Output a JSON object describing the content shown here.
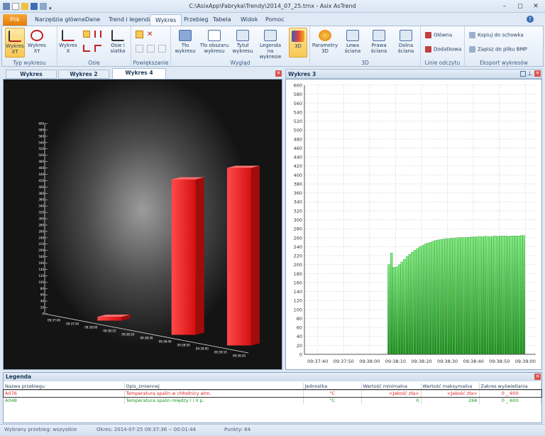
{
  "window": {
    "title": "C:\\AsixApp\\Fabryka\\Trendy\\2014_07_25.trnx - Asix AsTrend",
    "min": "–",
    "restore": "◻",
    "close": "✕"
  },
  "tabs": [
    {
      "label": "Plik"
    },
    {
      "label": "Narzędzia główne"
    },
    {
      "label": "Dane"
    },
    {
      "label": "Trend i legenda"
    },
    {
      "label": "Wykres"
    },
    {
      "label": "Przebieg"
    },
    {
      "label": "Tabela"
    },
    {
      "label": "Widok"
    },
    {
      "label": "Pomoc"
    }
  ],
  "ribbon": {
    "groups": {
      "typ": "Typ wykresu",
      "osie": "Osie",
      "pow": "Powiększanie",
      "wyglad": "Wygląd",
      "d3": "3D",
      "linie": "Linie odczytu",
      "eksport": "Eksport wykresów"
    },
    "wykres_xt": "Wykres XT",
    "wykres_xy": "Wykres XY",
    "wykres_x": "Wykres X",
    "osie_siatka": "Osie i siatka",
    "tlo_wykresu": "Tło wykresu",
    "tlo_obszaru": "Tło obszaru wykresu",
    "tytul": "Tytuł wykresu",
    "legenda_na": "Legenda na wykresie",
    "btn3d": "3D",
    "parametry": "Parametry 3D",
    "lewa": "Lewa ściana",
    "prawa": "Prawa ściana",
    "dolna": "Dolna ściana",
    "glowna": "Główna",
    "dodatkowa": "Dodatkowa",
    "kopiuj": "Kopiuj do schowka",
    "zapisz": "Zapisz do pliku BMP"
  },
  "doc_tabs": [
    {
      "label": "Wykres"
    },
    {
      "label": "Wykres 2"
    },
    {
      "label": "Wykres 4"
    }
  ],
  "panel3_title": "Wykres 3",
  "chart_data": [
    {
      "type": "bar",
      "title": "Wykres 4",
      "note": "3D bar chart",
      "ylim": [
        0,
        600
      ],
      "ytick_labels": [
        "0",
        "20",
        "40",
        "60",
        "80",
        "100",
        "120",
        "140",
        "160",
        "180",
        "200",
        "220",
        "240",
        "260",
        "280",
        "300",
        "320",
        "340",
        "360",
        "380",
        "400",
        "420",
        "440",
        "460",
        "480",
        "500",
        "520",
        "540",
        "560",
        "580",
        "600"
      ],
      "categories": [
        "09:37:40",
        "09:37:50",
        "09:38:00",
        "09:38:10",
        "09:38:20",
        "09:38:30",
        "09:38:40",
        "09:38:50",
        "09:39:00",
        "09:39:10",
        "09:39:20"
      ],
      "bar_colors": [
        "#e8191b"
      ],
      "values": [
        0,
        0,
        0,
        12,
        0,
        0,
        0,
        490,
        0,
        0,
        560
      ]
    },
    {
      "type": "bar",
      "title": "Wykres 3",
      "ylim": [
        0,
        600
      ],
      "grid": true,
      "color": "#2dcb2d",
      "ytick_labels": [
        "0",
        "20",
        "40",
        "60",
        "80",
        "100",
        "120",
        "140",
        "160",
        "180",
        "200",
        "220",
        "240",
        "260",
        "280",
        "300",
        "320",
        "340",
        "360",
        "380",
        "400",
        "420",
        "440",
        "460",
        "480",
        "500",
        "520",
        "540",
        "560",
        "580",
        "600"
      ],
      "xtick_labels": [
        "09:37:40",
        "09:37:50",
        "09:38:00",
        "09:38:10",
        "09:38:20",
        "09:38:30",
        "09:38:40",
        "09:38:50",
        "09:39:00",
        "09:39:10",
        "09:39:20"
      ],
      "x_start": "09:37:36",
      "x_step_s": 1,
      "values": [
        0,
        0,
        0,
        0,
        0,
        0,
        0,
        0,
        0,
        0,
        0,
        0,
        0,
        0,
        0,
        0,
        0,
        0,
        0,
        0,
        0,
        0,
        0,
        0,
        0,
        0,
        0,
        0,
        0,
        0,
        0,
        200,
        226,
        194,
        195,
        200,
        206,
        212,
        218,
        223,
        228,
        232,
        236,
        240,
        243,
        246,
        248,
        250,
        252,
        254,
        255,
        256,
        257,
        258,
        258,
        259,
        259,
        260,
        260,
        261,
        260,
        261,
        261,
        262,
        262,
        262,
        263,
        262,
        263,
        263,
        262,
        263,
        264,
        263,
        264,
        264,
        264,
        263,
        264,
        264,
        264,
        264,
        265,
        265
      ]
    }
  ],
  "legend": {
    "title": "Legenda",
    "headers": [
      "Nazwa przebiegu",
      "Opis_zmiennej",
      "Jednostka",
      "Wartość minimalna",
      "Wartość maksymalna",
      "Zakres wyświetlania"
    ],
    "rows": [
      {
        "name": "A076",
        "desc": "Temperatura spalin w chłodnicy atm.",
        "unit": "°C",
        "min": "<Jakość zła>",
        "max": "<Jakość zła>",
        "range": "0 _ 600",
        "color": "#e02020"
      },
      {
        "name": "A048",
        "desc": "Temperatura spalin między I i II p.",
        "unit": "°C",
        "min": "0",
        "max": "266",
        "range": "0 _ 600",
        "color": "#1a9a1a"
      }
    ]
  },
  "status": {
    "a": "Wybrany przebieg: wszystkie",
    "b": "Okres: 2014-07-25 09:37:36 -- 00:01:44",
    "c": "Punkty: 84"
  },
  "colors": {
    "accent": "#e57b06",
    "red_bar": "#e8191b",
    "green_bar": "#2dcb2d"
  }
}
